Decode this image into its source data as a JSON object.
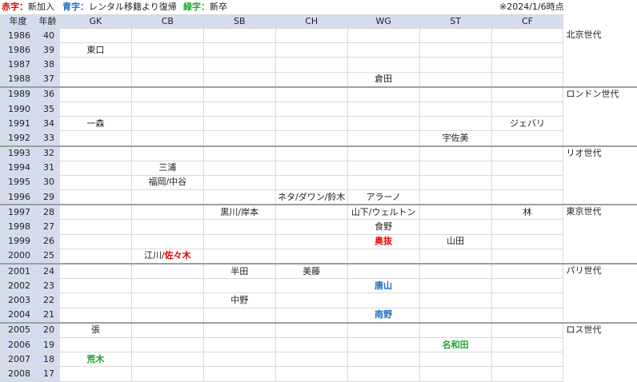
{
  "legend": {
    "red_label": "赤字：",
    "red_text": "新加入",
    "blue_label": "青字：",
    "blue_text": "レンタル移籍より復帰",
    "green_label": "緑字：",
    "green_text": "新卒",
    "asof": "※2024/1/6時点"
  },
  "header": {
    "year": "年度",
    "age": "年齢",
    "positions": [
      "GK",
      "CB",
      "SB",
      "CH",
      "WG",
      "ST",
      "CF"
    ]
  },
  "rows": [
    {
      "year": "1986",
      "age": "40",
      "cells": [
        "",
        "",
        "",
        "",
        "",
        "",
        ""
      ]
    },
    {
      "year": "1986",
      "age": "39",
      "cells": [
        "東口",
        "",
        "",
        "",
        "",
        "",
        ""
      ]
    },
    {
      "year": "1987",
      "age": "38",
      "cells": [
        "",
        "",
        "",
        "",
        "",
        "",
        ""
      ]
    },
    {
      "year": "1988",
      "age": "37",
      "cells": [
        "",
        "",
        "",
        "",
        "倉田",
        "",
        ""
      ]
    },
    {
      "year": "1989",
      "age": "36",
      "cells": [
        "",
        "",
        "",
        "",
        "",
        "",
        ""
      ]
    },
    {
      "year": "1990",
      "age": "35",
      "cells": [
        "",
        "",
        "",
        "",
        "",
        "",
        ""
      ]
    },
    {
      "year": "1991",
      "age": "34",
      "cells": [
        "一森",
        "",
        "",
        "",
        "",
        "",
        "ジェバリ"
      ]
    },
    {
      "year": "1992",
      "age": "33",
      "cells": [
        "",
        "",
        "",
        "",
        "",
        "宇佐美",
        ""
      ]
    },
    {
      "year": "1993",
      "age": "32",
      "cells": [
        "",
        "",
        "",
        "",
        "",
        "",
        ""
      ]
    },
    {
      "year": "1994",
      "age": "31",
      "cells": [
        "",
        "三浦",
        "",
        "",
        "",
        "",
        ""
      ]
    },
    {
      "year": "1995",
      "age": "30",
      "cells": [
        "",
        "福岡/中谷",
        "",
        "",
        "",
        "",
        ""
      ]
    },
    {
      "year": "1996",
      "age": "29",
      "cells": [
        "",
        "",
        "",
        "ネタ/ダワン/鈴木",
        "アラーノ",
        "",
        ""
      ]
    },
    {
      "year": "1997",
      "age": "28",
      "cells": [
        "",
        "",
        "黒川/岸本",
        "",
        "山下/ウェルトン",
        "",
        "林"
      ]
    },
    {
      "year": "1998",
      "age": "27",
      "cells": [
        "",
        "",
        "",
        "",
        "食野",
        "",
        ""
      ]
    },
    {
      "year": "1999",
      "age": "26",
      "cells": [
        "",
        "",
        "",
        "",
        "奥抜",
        "山田",
        ""
      ]
    },
    {
      "year": "2000",
      "age": "25",
      "cells": [
        "",
        "江川/",
        "",
        "",
        "",
        "",
        ""
      ],
      "extra_cb": "佐々木"
    },
    {
      "year": "2001",
      "age": "24",
      "cells": [
        "",
        "",
        "半田",
        "美藤",
        "",
        "",
        ""
      ]
    },
    {
      "year": "2002",
      "age": "23",
      "cells": [
        "",
        "",
        "",
        "",
        "唐山",
        "",
        ""
      ]
    },
    {
      "year": "2003",
      "age": "22",
      "cells": [
        "",
        "",
        "中野",
        "",
        "",
        "",
        ""
      ]
    },
    {
      "year": "2004",
      "age": "21",
      "cells": [
        "",
        "",
        "",
        "",
        "南野",
        "",
        ""
      ]
    },
    {
      "year": "2005",
      "age": "20",
      "cells": [
        "張",
        "",
        "",
        "",
        "",
        "",
        ""
      ]
    },
    {
      "year": "2006",
      "age": "19",
      "cells": [
        "",
        "",
        "",
        "",
        "",
        "名和田",
        ""
      ]
    },
    {
      "year": "2007",
      "age": "18",
      "cells": [
        "荒木",
        "",
        "",
        "",
        "",
        "",
        ""
      ]
    },
    {
      "year": "2008",
      "age": "17",
      "cells": [
        "",
        "",
        "",
        "",
        "",
        "",
        ""
      ]
    }
  ],
  "generations": [
    "北京世代",
    "ロンドン世代",
    "リオ世代",
    "東京世代",
    "パリ世代",
    "ロス世代"
  ],
  "colors": {
    "red": "#e00000",
    "blue": "#1f6fc4",
    "green": "#1aa52a",
    "header_bg": "#d6dcef"
  }
}
